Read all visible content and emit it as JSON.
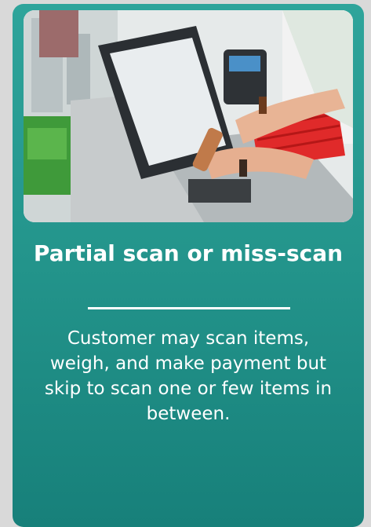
{
  "card": {
    "title": "Partial scan or miss-scan",
    "description": "Customer may scan items, weigh, and make payment but skip to scan one or few items in between."
  },
  "colors": {
    "card_teal_top": "#2ea49b",
    "card_teal_bottom": "#17807a",
    "page_background": "#d9d9d9",
    "text": "#ffffff"
  }
}
